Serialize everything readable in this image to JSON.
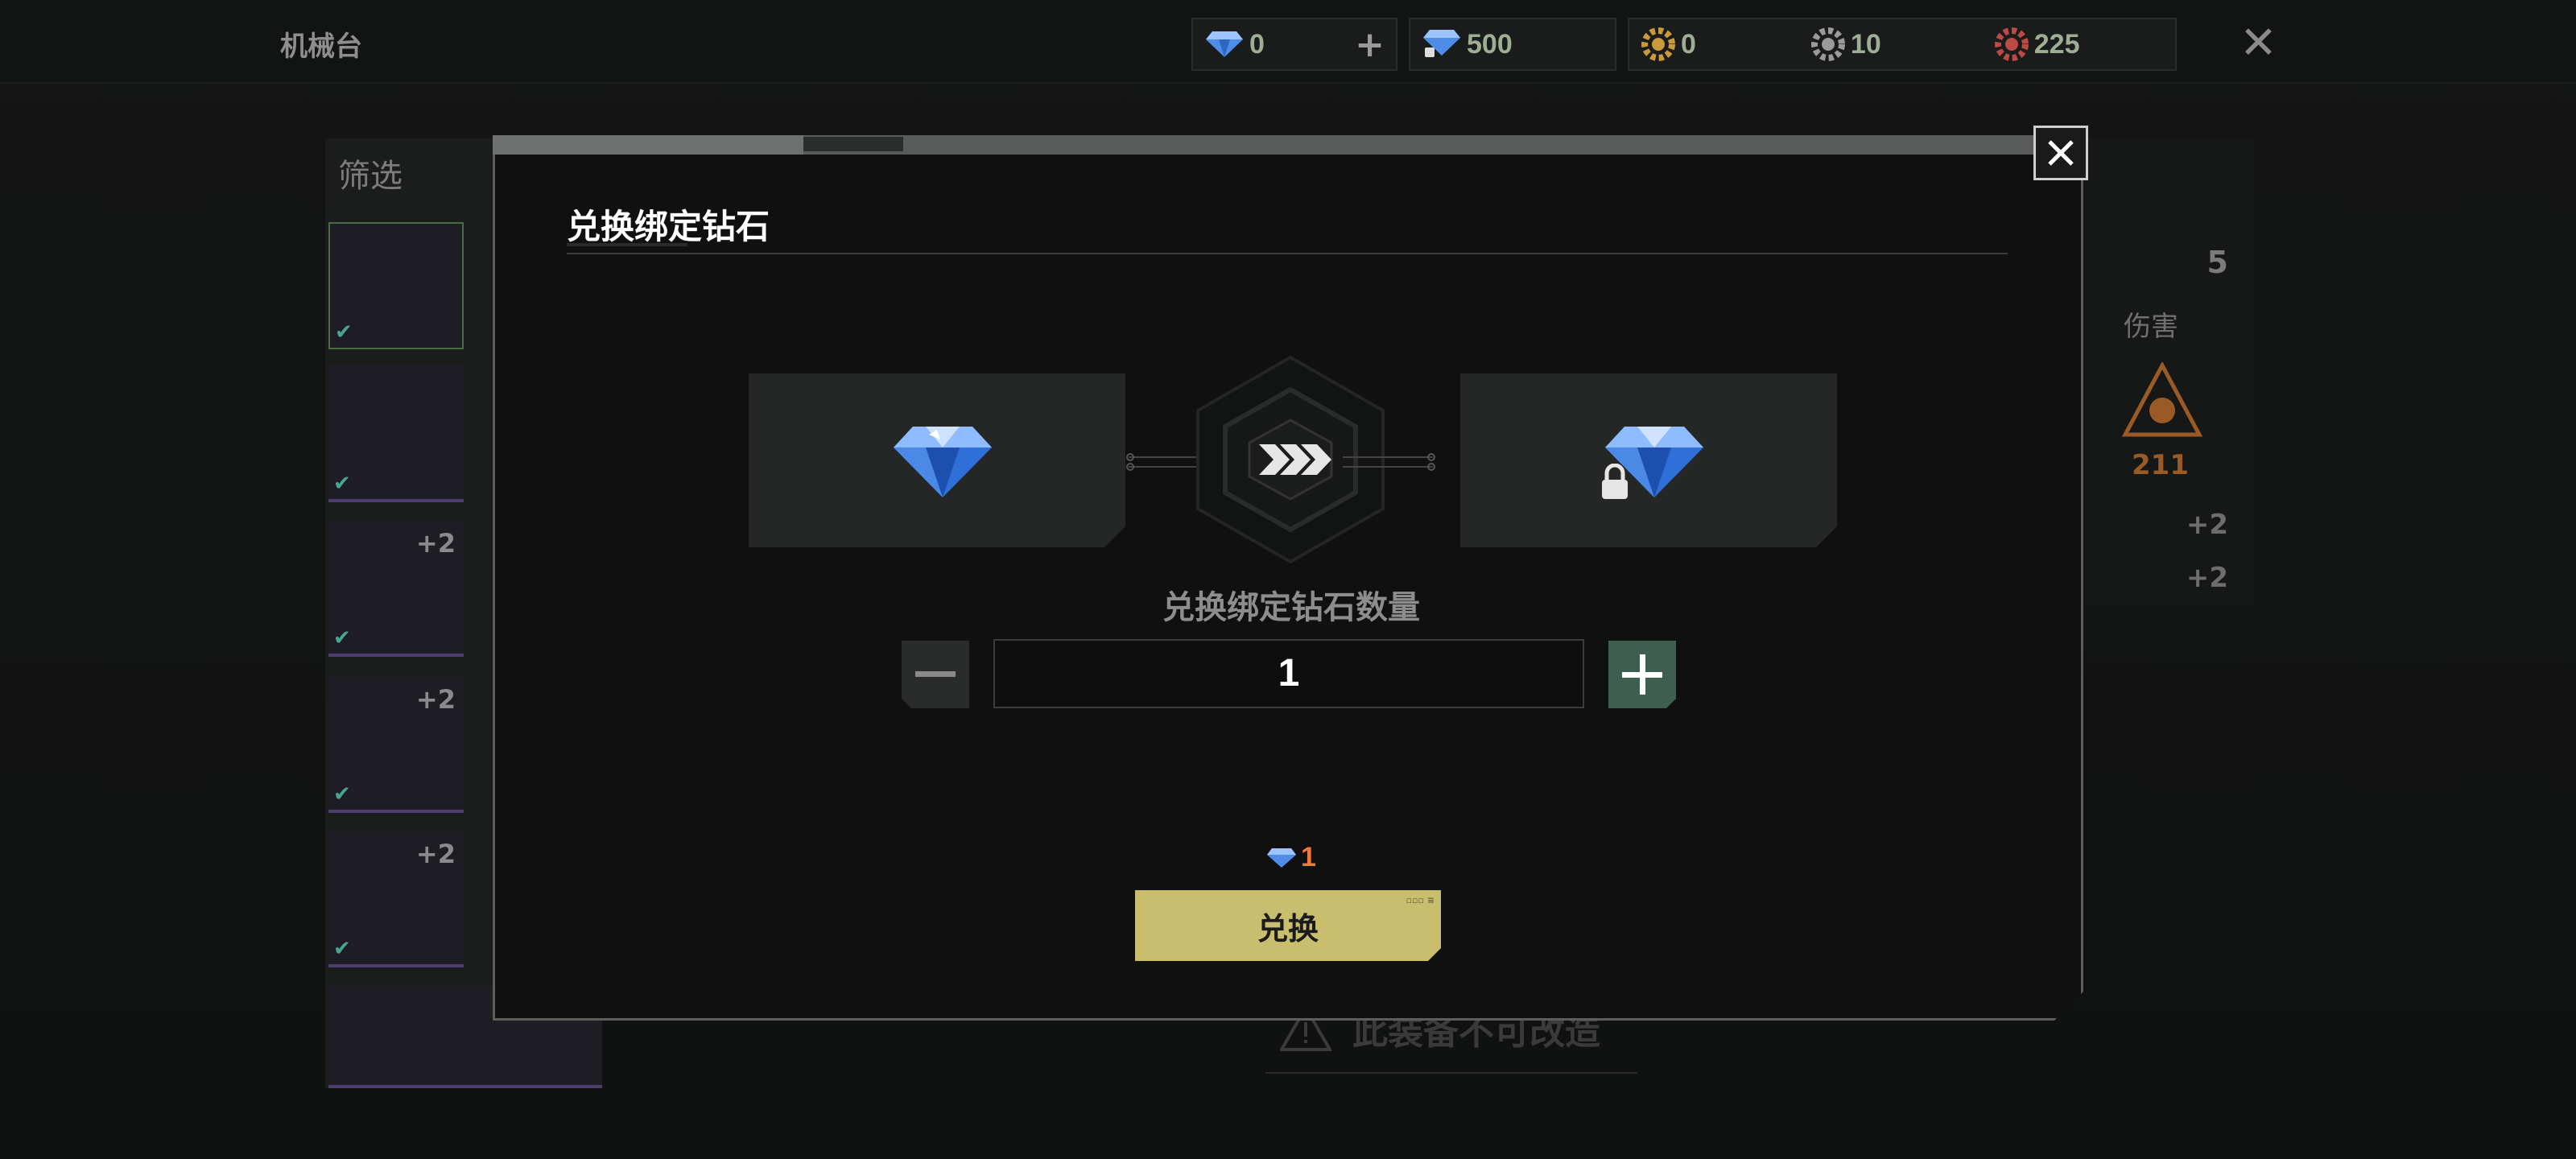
{
  "screen": {
    "title": "机械台"
  },
  "currencies": [
    {
      "icon": "diamond-icon",
      "value": "0",
      "has_plus": true
    },
    {
      "icon": "bound-diamond-icon",
      "value": "500"
    },
    {
      "icon": "gold-gear-icon",
      "value": "0"
    },
    {
      "icon": "silver-gear-icon",
      "value": "10"
    },
    {
      "icon": "red-gear-icon",
      "value": "225"
    }
  ],
  "background": {
    "filter_label": "筛选",
    "slots": [
      {
        "badge": ""
      },
      {
        "badge": ""
      },
      {
        "badge": "+2"
      },
      {
        "badge": "+2"
      },
      {
        "badge": "+2"
      }
    ],
    "stats": {
      "count": "5",
      "damage_label": "伤害",
      "damage_value": "211",
      "mod1": "+2",
      "mod2": "+2"
    },
    "warning": "此装备不可改造"
  },
  "dialog": {
    "title": "兑换绑定钻石",
    "quantity_label": "兑换绑定钻石数量",
    "quantity": "1",
    "cost": "1",
    "exchange_label": "兑换"
  },
  "colors": {
    "accent_yellow": "#c9be6d",
    "plus_green": "#3e5e50",
    "cost_orange": "#f07a3a",
    "currency_text": "#9eae94"
  }
}
